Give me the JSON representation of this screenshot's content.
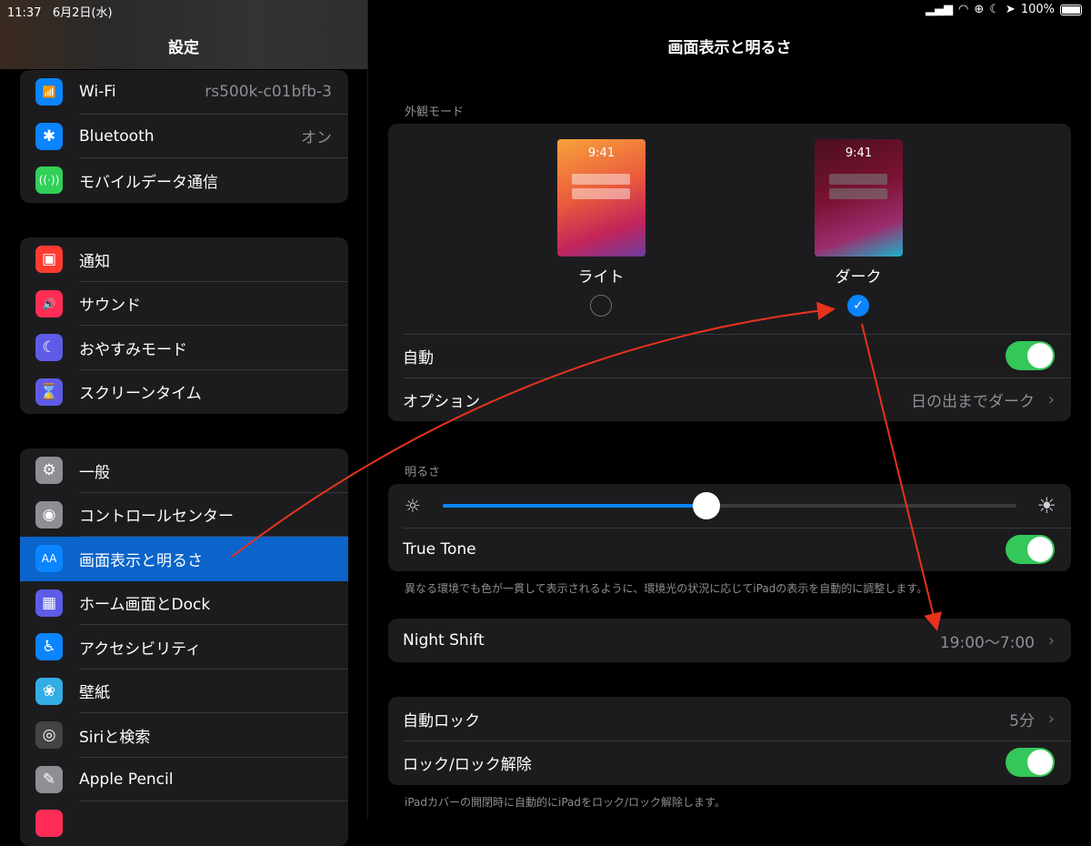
{
  "status": {
    "time": "11:37",
    "date": "6月2日(水)",
    "battery": "100%"
  },
  "sidebar": {
    "title": "設定",
    "groups": [
      [
        {
          "label": "Wi-Fi",
          "value": "rs500k-c01bfb-3",
          "icon": "wifi-icon",
          "color": "#0a84ff",
          "glyph": "📶"
        },
        {
          "label": "Bluetooth",
          "value": "オン",
          "icon": "bluetooth-icon",
          "color": "#0a84ff",
          "glyph": "✱"
        },
        {
          "label": "モバイルデータ通信",
          "value": "",
          "icon": "antenna-icon",
          "color": "#30d158",
          "glyph": "((·))"
        }
      ],
      [
        {
          "label": "通知",
          "icon": "notification-icon",
          "color": "#ff3b30",
          "glyph": "▣"
        },
        {
          "label": "サウンド",
          "icon": "speaker-icon",
          "color": "#ff2d55",
          "glyph": "🔊"
        },
        {
          "label": "おやすみモード",
          "icon": "moon-icon",
          "color": "#5e5ce6",
          "glyph": "☾"
        },
        {
          "label": "スクリーンタイム",
          "icon": "hourglass-icon",
          "color": "#5e5ce6",
          "glyph": "⌛"
        }
      ],
      [
        {
          "label": "一般",
          "icon": "gear-icon",
          "color": "#8e8e93",
          "glyph": "⚙"
        },
        {
          "label": "コントロールセンター",
          "icon": "toggles-icon",
          "color": "#8e8e93",
          "glyph": "◉"
        },
        {
          "label": "画面表示と明るさ",
          "icon": "text-size-icon",
          "color": "#0a84ff",
          "glyph": "AA",
          "selected": true
        },
        {
          "label": "ホーム画面とDock",
          "icon": "home-grid-icon",
          "color": "#5e5ce6",
          "glyph": "▦"
        },
        {
          "label": "アクセシビリティ",
          "icon": "accessibility-icon",
          "color": "#0a84ff",
          "glyph": "♿"
        },
        {
          "label": "壁紙",
          "icon": "flower-icon",
          "color": "#32ade6",
          "glyph": "❀"
        },
        {
          "label": "Siriと検索",
          "icon": "siri-icon",
          "color": "#444",
          "glyph": "◎"
        },
        {
          "label": "Apple Pencil",
          "icon": "pencil-icon",
          "color": "#8e8e93",
          "glyph": "✎"
        },
        {
          "label": "",
          "icon": "fingerprint-icon",
          "color": "#ff2d55",
          "glyph": ""
        }
      ]
    ]
  },
  "main": {
    "title": "画面表示と明るさ",
    "appearance": {
      "section_label": "外観モード",
      "light_label": "ライト",
      "dark_label": "ダーク",
      "preview_time": "9:41",
      "auto_label": "自動",
      "option_label": "オプション",
      "option_value": "日の出までダーク"
    },
    "brightness": {
      "section_label": "明るさ",
      "level": 0.46,
      "true_tone_label": "True Tone",
      "true_tone_note": "異なる環境でも色が一貫して表示されるように、環境光の状況に応じてiPadの表示を自動的に調整します。"
    },
    "night_shift": {
      "label": "Night Shift",
      "value": "19:00〜7:00"
    },
    "lock": {
      "auto_lock_label": "自動ロック",
      "auto_lock_value": "5分",
      "lock_unlock_label": "ロック/ロック解除",
      "note": "iPadカバーの開閉時に自動的にiPadをロック/ロック解除します。"
    }
  },
  "colors": {
    "accent": "#0a84ff",
    "toggle_on": "#34c759",
    "annotation": "#e8321e"
  }
}
